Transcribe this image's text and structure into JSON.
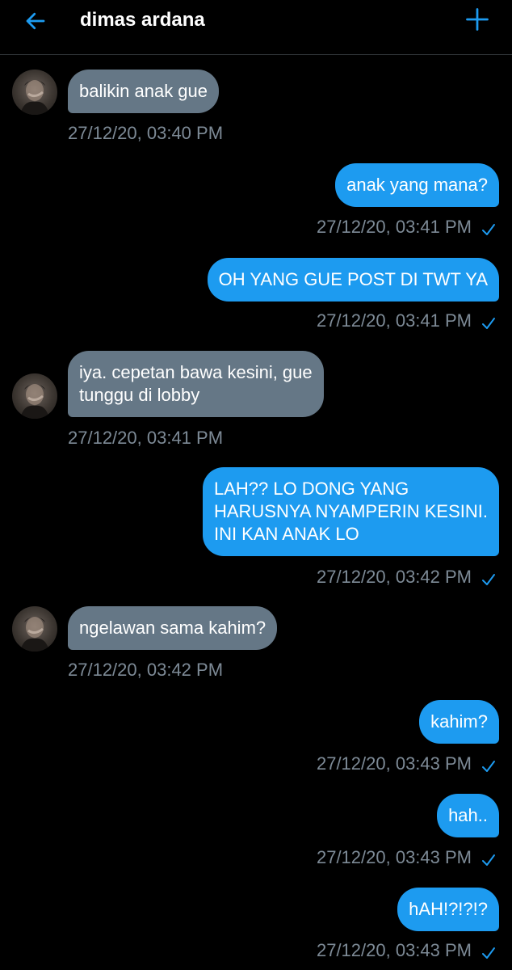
{
  "header": {
    "title": "dimas ardana",
    "back_icon": "arrow-left-icon",
    "new_icon": "plus-icon",
    "accent_color": "#1d9bf0"
  },
  "colors": {
    "background": "#000000",
    "incoming_bubble": "#657786",
    "outgoing_bubble": "#1d9bf0",
    "timestamp": "#7d8a96"
  },
  "messages": [
    {
      "direction": "in",
      "lines": [
        "balikin anak gue"
      ],
      "timestamp": "27/12/20, 03:40 PM"
    },
    {
      "direction": "out",
      "lines": [
        "anak yang mana?"
      ],
      "timestamp": "27/12/20, 03:41 PM",
      "read": true
    },
    {
      "direction": "out",
      "lines": [
        "OH YANG GUE POST DI TWT YA"
      ],
      "timestamp": "27/12/20, 03:41 PM",
      "read": true
    },
    {
      "direction": "in",
      "lines": [
        "iya. cepetan bawa kesini, gue",
        "tunggu di lobby"
      ],
      "timestamp": "27/12/20, 03:41 PM"
    },
    {
      "direction": "out",
      "lines": [
        "LAH?? LO DONG YANG",
        "HARUSNYA NYAMPERIN KESINI.",
        "INI KAN ANAK LO"
      ],
      "timestamp": "27/12/20, 03:42 PM",
      "read": true
    },
    {
      "direction": "in",
      "lines": [
        "ngelawan sama kahim?"
      ],
      "timestamp": "27/12/20, 03:42 PM"
    },
    {
      "direction": "out",
      "lines": [
        "kahim?"
      ],
      "timestamp": "27/12/20, 03:43 PM",
      "read": true
    },
    {
      "direction": "out",
      "lines": [
        "hah.."
      ],
      "timestamp": "27/12/20, 03:43 PM",
      "read": true
    },
    {
      "direction": "out",
      "lines": [
        "hAH!?!?!?"
      ],
      "timestamp": "27/12/20, 03:43 PM",
      "read": true
    }
  ]
}
